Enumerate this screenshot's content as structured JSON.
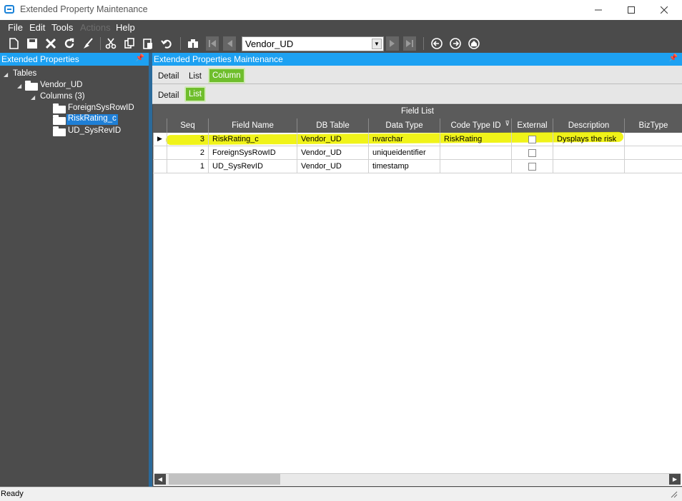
{
  "window": {
    "title": "Extended Property Maintenance"
  },
  "menu": [
    "File",
    "Edit",
    "Tools",
    "Actions",
    "Help"
  ],
  "toolbar": {
    "vendor_value": "Vendor_UD"
  },
  "left_panel": {
    "title": "Extended Properties",
    "tree": {
      "root": "Tables",
      "table": "Vendor_UD",
      "columns_label": "Columns (3)",
      "columns": [
        "ForeignSysRowID",
        "RiskRating_c",
        "UD_SysRevID"
      ]
    }
  },
  "right_panel": {
    "title": "Extended Properties Maintenance",
    "tabs_top": [
      "Detail",
      "List",
      "Column"
    ],
    "tabs_sub": [
      "Detail",
      "List"
    ]
  },
  "grid": {
    "title": "Field List",
    "columns": [
      "Seq",
      "Field Name",
      "DB Table",
      "Data Type",
      "Code Type ID",
      "External",
      "Description",
      "BizType"
    ],
    "rows": [
      {
        "seq": "3",
        "field": "RiskRating_c",
        "table": "Vendor_UD",
        "type": "nvarchar",
        "code": "RiskRating",
        "desc": "Dysplays the risk",
        "biz": ""
      },
      {
        "seq": "2",
        "field": "ForeignSysRowID",
        "table": "Vendor_UD",
        "type": "uniqueidentifier",
        "code": "",
        "desc": "",
        "biz": ""
      },
      {
        "seq": "1",
        "field": "UD_SysRevID",
        "table": "Vendor_UD",
        "type": "timestamp",
        "code": "",
        "desc": "",
        "biz": ""
      }
    ]
  },
  "status": "Ready",
  "colors": {
    "accent": "#1da1f2",
    "tab_active": "#6fbe2c",
    "highlight": "#eef200",
    "dark": "#4b4b4b"
  }
}
